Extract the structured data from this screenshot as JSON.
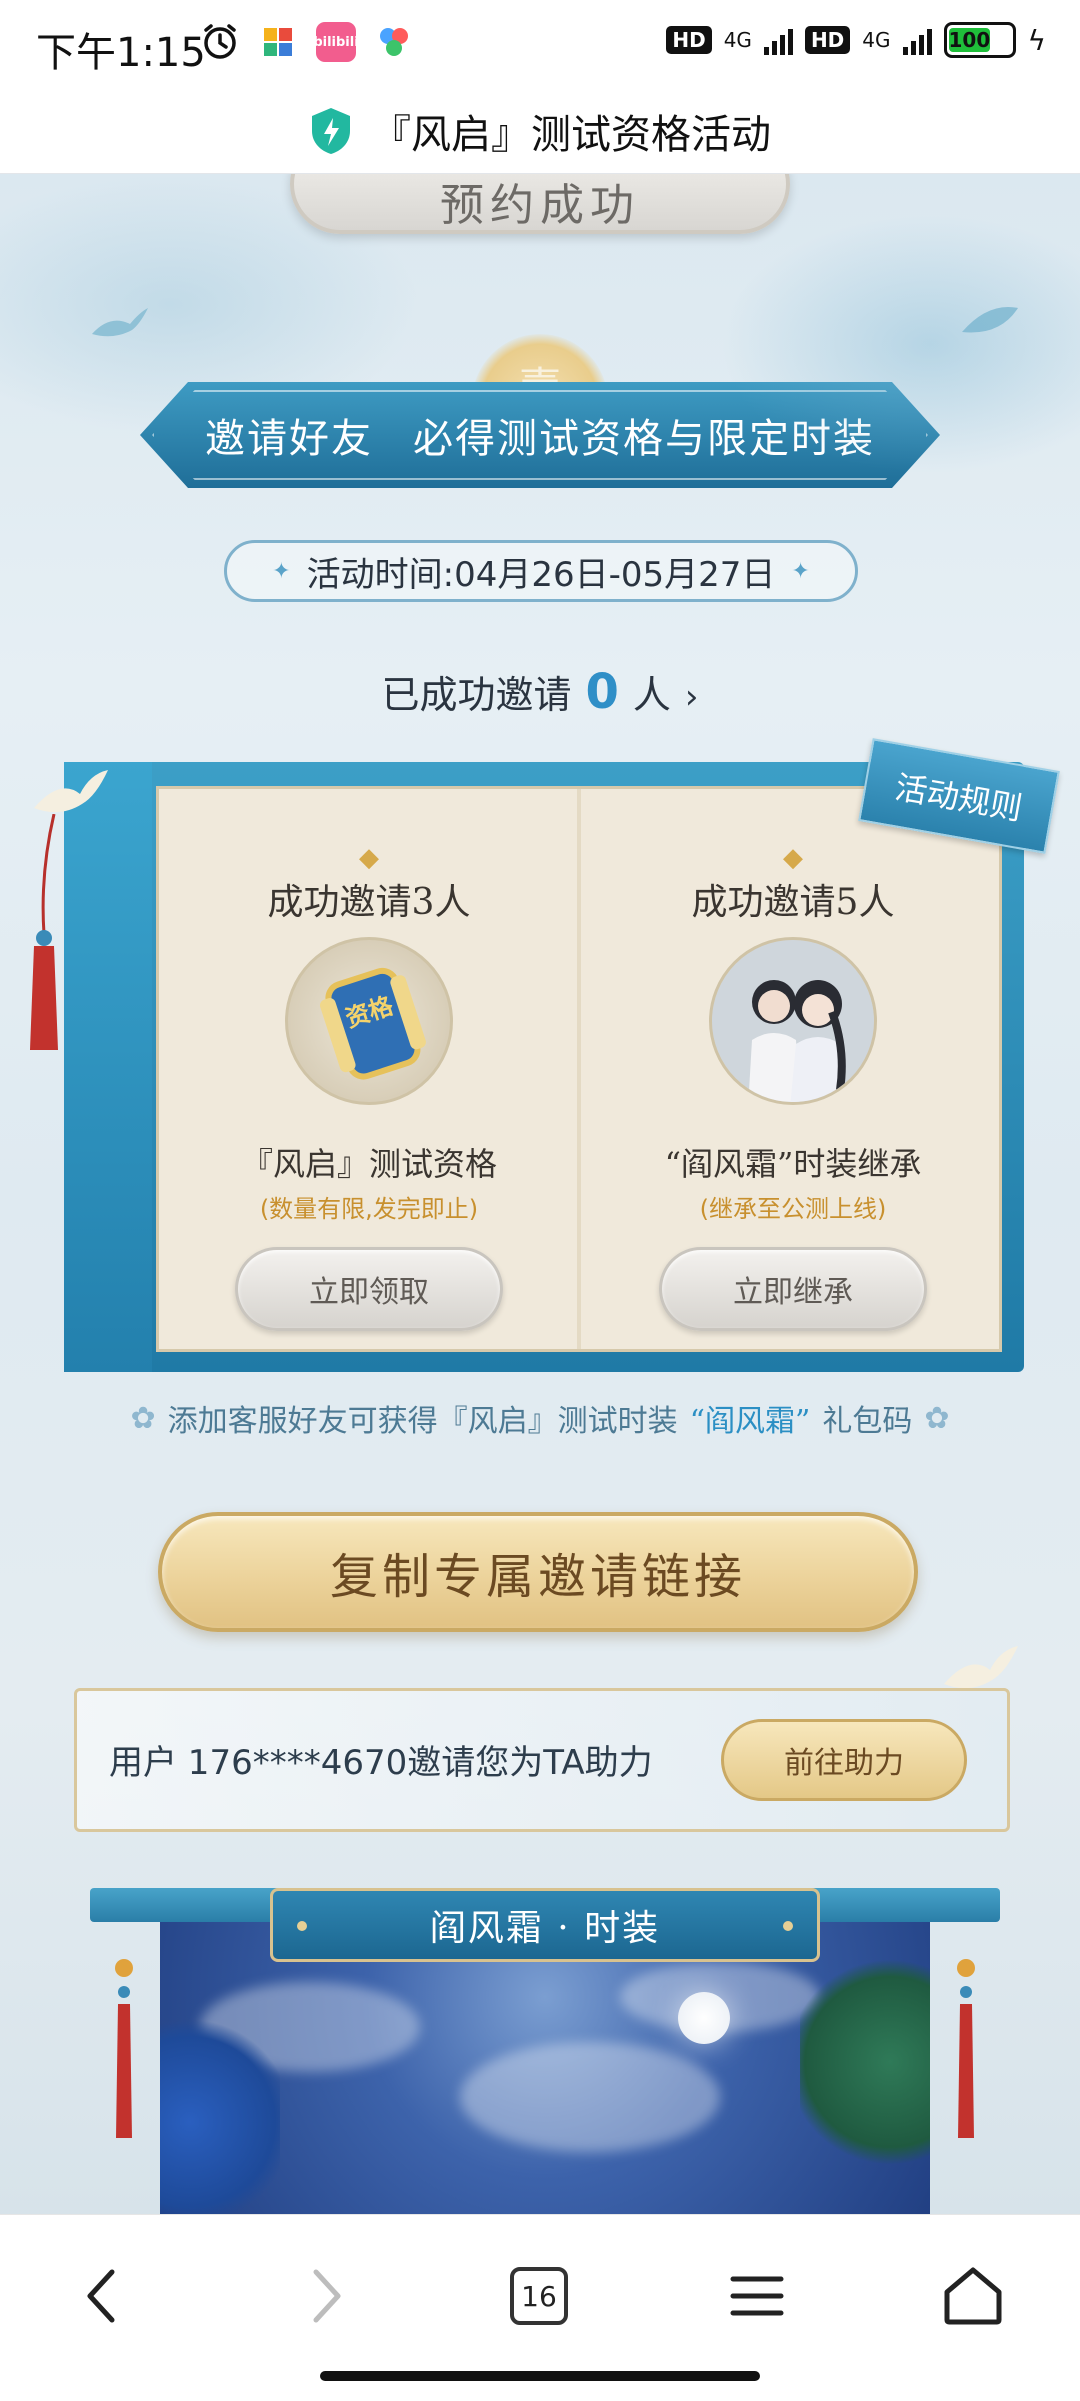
{
  "status_bar": {
    "time": "下午1:15",
    "alarm_icon": "alarm-clock-icon",
    "apps": [
      {
        "name": "app-icon-1",
        "color": "#2fb67c"
      },
      {
        "name": "bilibili-icon",
        "color": "#f25d8e",
        "label": "bilibili"
      },
      {
        "name": "app-icon-3",
        "color": "#4aa3ff"
      }
    ],
    "hd1": "HD",
    "net1": "4G",
    "hd2": "HD",
    "net2": "4G",
    "battery": "100"
  },
  "title_bar": {
    "title": "『风启』测试资格活动",
    "shield_color": "#22b8a0"
  },
  "hero": {
    "reserve_badge": "预约成功",
    "section_mark": "壹",
    "invite_banner_left": "邀请好友",
    "invite_banner_right": "必得测试资格与限定时装",
    "activity_time": "活动时间:04月26日-05月27日",
    "invited_prefix": "已成功邀请",
    "invited_count": "0",
    "invited_suffix": "人",
    "invited_arrow": "›"
  },
  "rules_tag": "活动规则",
  "rewards": [
    {
      "heading": "成功邀请3人",
      "item": "『风启』测试资格",
      "note": "(数量有限,发完即止)",
      "button": "立即领取",
      "medal_text": "资格"
    },
    {
      "heading": "成功邀请5人",
      "item": "“阎风霜”时装继承",
      "note": "(继承至公测上线)",
      "button": "立即继承"
    }
  ],
  "service_tip": {
    "prefix": "添加客服好友可获得『风启』测试时装",
    "highlight": "“阎风霜”",
    "suffix": "礼包码"
  },
  "copy_button": "复制专属邀请链接",
  "help_card": {
    "text": "用户 176****4670邀请您为TA助力",
    "button": "前往助力"
  },
  "costume_section": {
    "plaque": "阎风霜 · 时装"
  },
  "nav": {
    "tab_count": "16"
  },
  "colors": {
    "accent_blue": "#2f8fc7",
    "gold": "#c8902e"
  }
}
